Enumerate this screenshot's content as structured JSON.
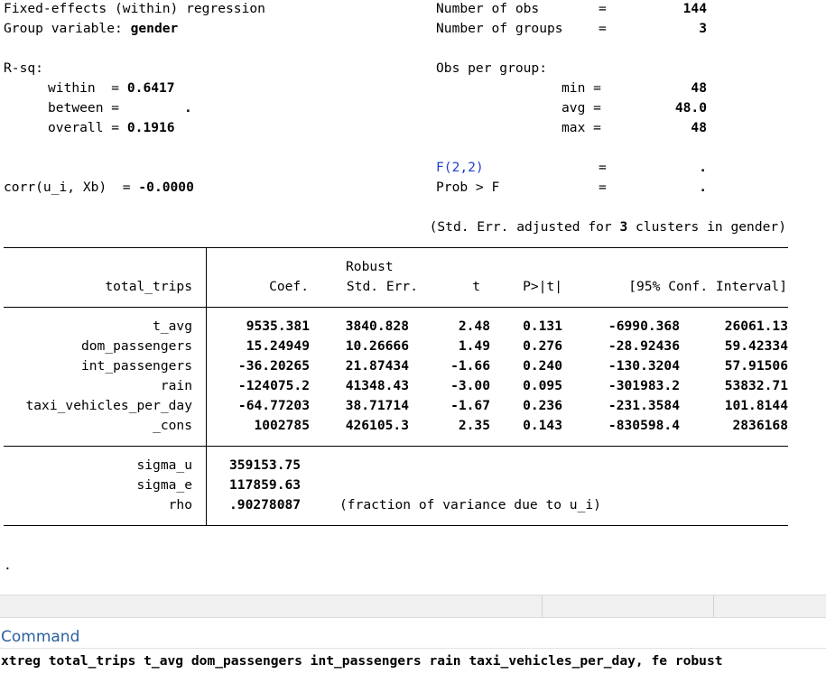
{
  "header": {
    "title": "Fixed-effects (within) regression",
    "group_label": "Group variable: ",
    "group_var": "gender",
    "nobs_label": "Number of obs",
    "nobs_eq": "=",
    "nobs": "144",
    "ngroups_label": "Number of groups",
    "ngroups_eq": "=",
    "ngroups": "3",
    "rsq_label": "R-sq:",
    "within_label": "within  = ",
    "within": "0.6417",
    "between_label": "between =",
    "between": ".",
    "overall_label": "overall = ",
    "overall": "0.1916",
    "obs_per_group_label": "Obs per group:",
    "min_label": "min =",
    "min": "48",
    "avg_label": "avg =",
    "avg": "48.0",
    "max_label": "max =",
    "max": "48",
    "f_label": "F(2,2)",
    "f_eq": "=",
    "f_value": ".",
    "corr_label": "corr(u_i, Xb)  = ",
    "corr": "-0.0000",
    "prob_label": "Prob > F",
    "prob_eq": "=",
    "prob_value": ".",
    "stderr_note_pre": "(Std. Err. adjusted for ",
    "stderr_note_num": "3",
    "stderr_note_post": " clusters in gender)"
  },
  "table": {
    "depvar": "total_trips",
    "col_robust": "Robust",
    "col_coef": "Coef.",
    "col_se": "Std. Err.",
    "col_t": "t",
    "col_p": "P>|t|",
    "col_ci": "[95% Conf. Interval]",
    "rows": [
      {
        "var": "t_avg",
        "coef": "9535.381",
        "se": "3840.828",
        "t": "2.48",
        "p": "0.131",
        "lo": "-6990.368",
        "hi": "26061.13"
      },
      {
        "var": "dom_passengers",
        "coef": "15.24949",
        "se": "10.26666",
        "t": "1.49",
        "p": "0.276",
        "lo": "-28.92436",
        "hi": "59.42334"
      },
      {
        "var": "int_passengers",
        "coef": "-36.20265",
        "se": "21.87434",
        "t": "-1.66",
        "p": "0.240",
        "lo": "-130.3204",
        "hi": "57.91506"
      },
      {
        "var": "rain",
        "coef": "-124075.2",
        "se": "41348.43",
        "t": "-3.00",
        "p": "0.095",
        "lo": "-301983.2",
        "hi": "53832.71"
      },
      {
        "var": "taxi_vehicles_per_day",
        "coef": "-64.77203",
        "se": "38.71714",
        "t": "-1.67",
        "p": "0.236",
        "lo": "-231.3584",
        "hi": "101.8144"
      },
      {
        "var": "_cons",
        "coef": "1002785",
        "se": "426105.3",
        "t": "2.35",
        "p": "0.143",
        "lo": "-830598.4",
        "hi": "2836168"
      }
    ],
    "sigma_u_label": "sigma_u",
    "sigma_u": "359153.75",
    "sigma_e_label": "sigma_e",
    "sigma_e": "117859.63",
    "rho_label": "rho",
    "rho": ".90278087",
    "rho_note": "(fraction of variance due to u_i)"
  },
  "prompt_dot": ".",
  "command": {
    "title": "Command",
    "value": "xtreg total_trips t_avg dom_passengers int_passengers rain taxi_vehicles_per_day, fe robust"
  },
  "colors": {
    "command_title": "#2c5f9e",
    "f_label": "#1f3fd0"
  }
}
